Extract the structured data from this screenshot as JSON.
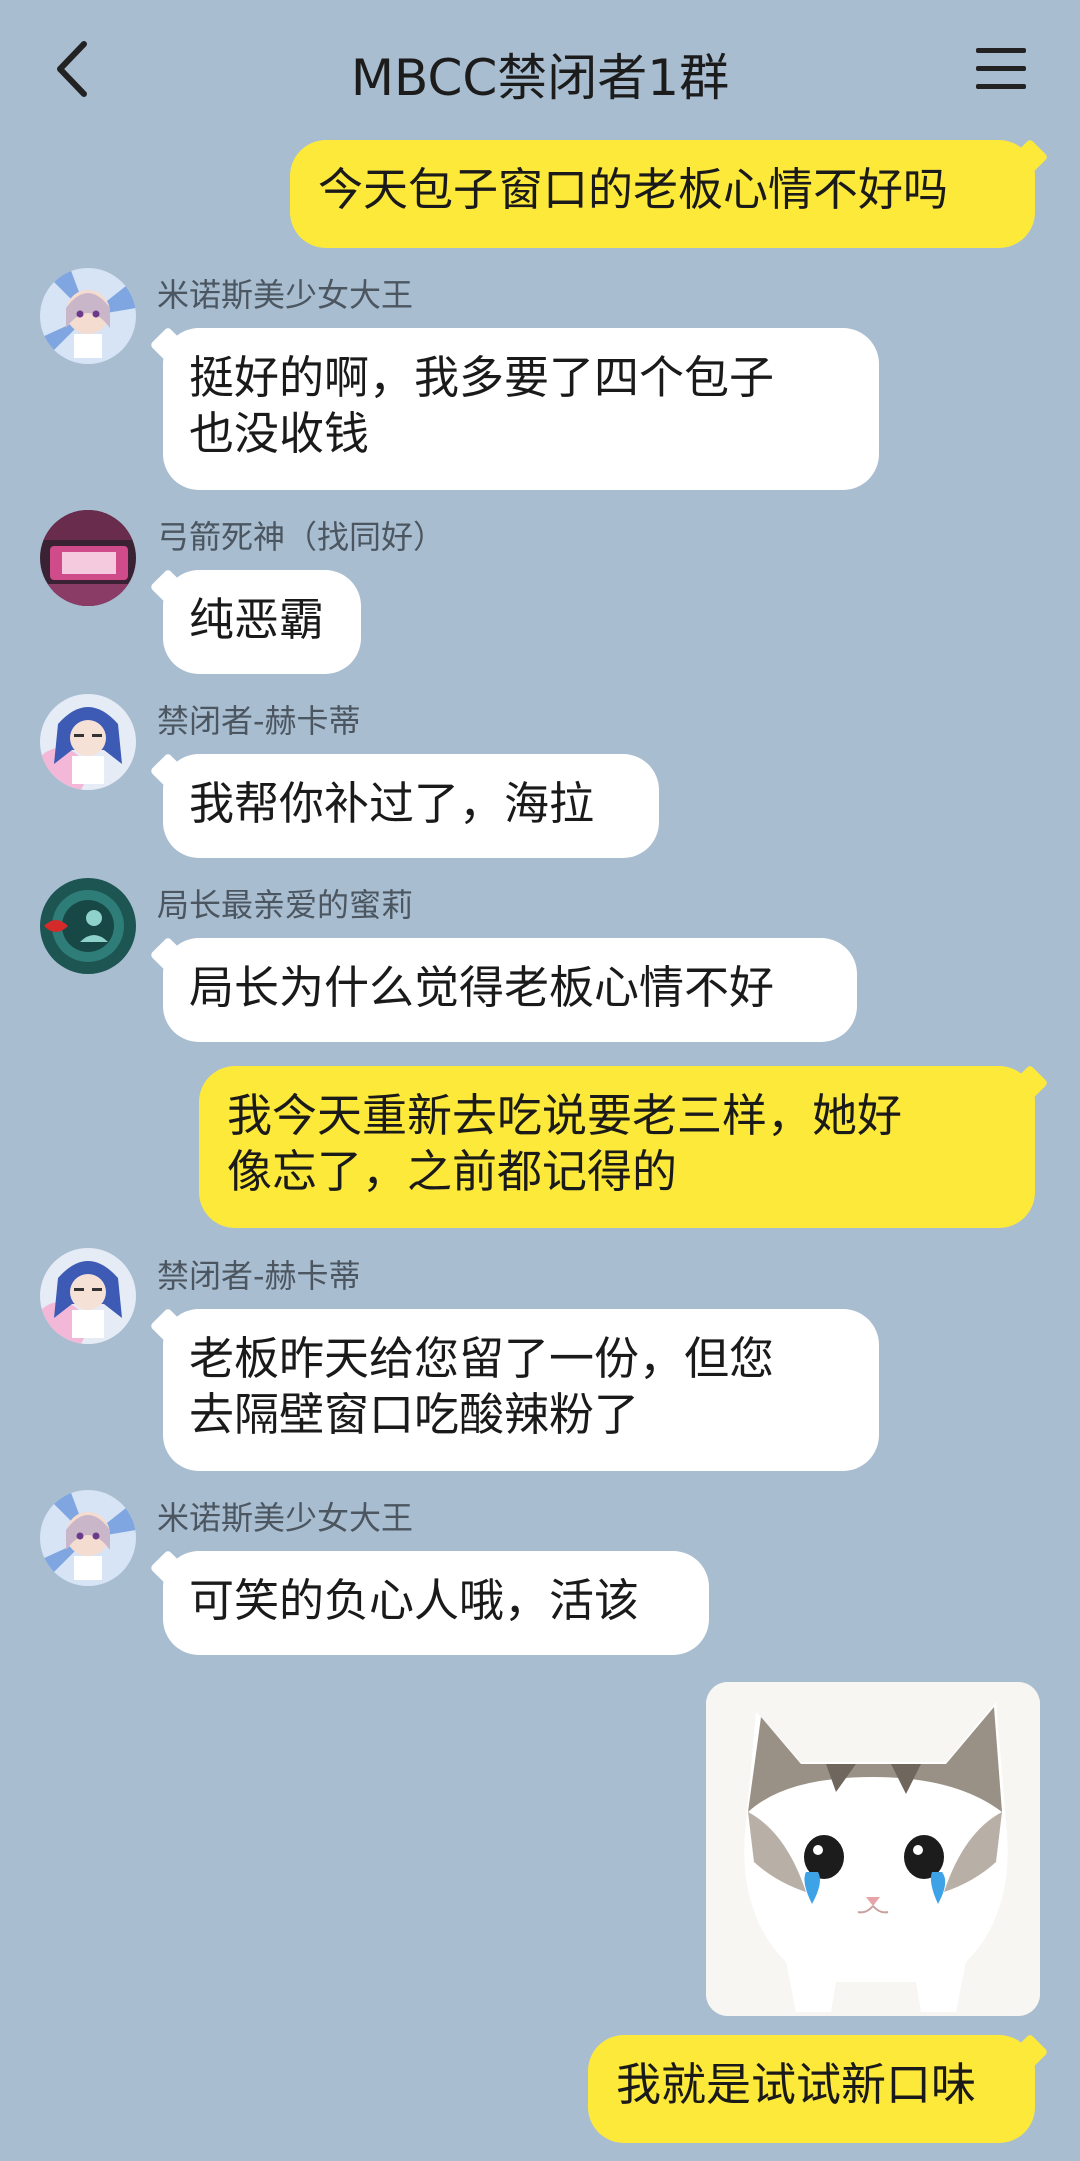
{
  "header": {
    "title": "MBCC禁闭者1群",
    "back_icon": "chevron-left-icon",
    "menu_icon": "hamburger-menu-icon"
  },
  "messages": [
    {
      "side": "out",
      "text": "今天包子窗口的老板心情不好吗"
    },
    {
      "side": "in",
      "sender": "米诺斯美少女大王",
      "text": "挺好的啊，我多要了四个包子\n也没收钱"
    },
    {
      "side": "in",
      "sender": "弓箭死神（找同好）",
      "text": "纯恶霸"
    },
    {
      "side": "in",
      "sender": "禁闭者-赫卡蒂",
      "text": "我帮你补过了，海拉"
    },
    {
      "side": "in",
      "sender": "局长最亲爱的蜜莉",
      "text": "局长为什么觉得老板心情不好"
    },
    {
      "side": "out",
      "text": "我今天重新去吃说要老三样，她好\n像忘了，之前都记得的"
    },
    {
      "side": "in",
      "sender": "禁闭者-赫卡蒂",
      "text": "老板昨天给您留了一份，但您\n去隔壁窗口吃酸辣粉了"
    },
    {
      "side": "in",
      "sender": "米诺斯美少女大王",
      "text": "可笑的负心人哦，活该"
    },
    {
      "side": "out",
      "type": "sticker",
      "sticker": "crying-cat-sticker"
    },
    {
      "side": "out",
      "text": "我就是试试新口味"
    }
  ],
  "colors": {
    "background": "#a9bdd1",
    "outgoing": "#fde93a",
    "incoming": "#ffffff"
  }
}
